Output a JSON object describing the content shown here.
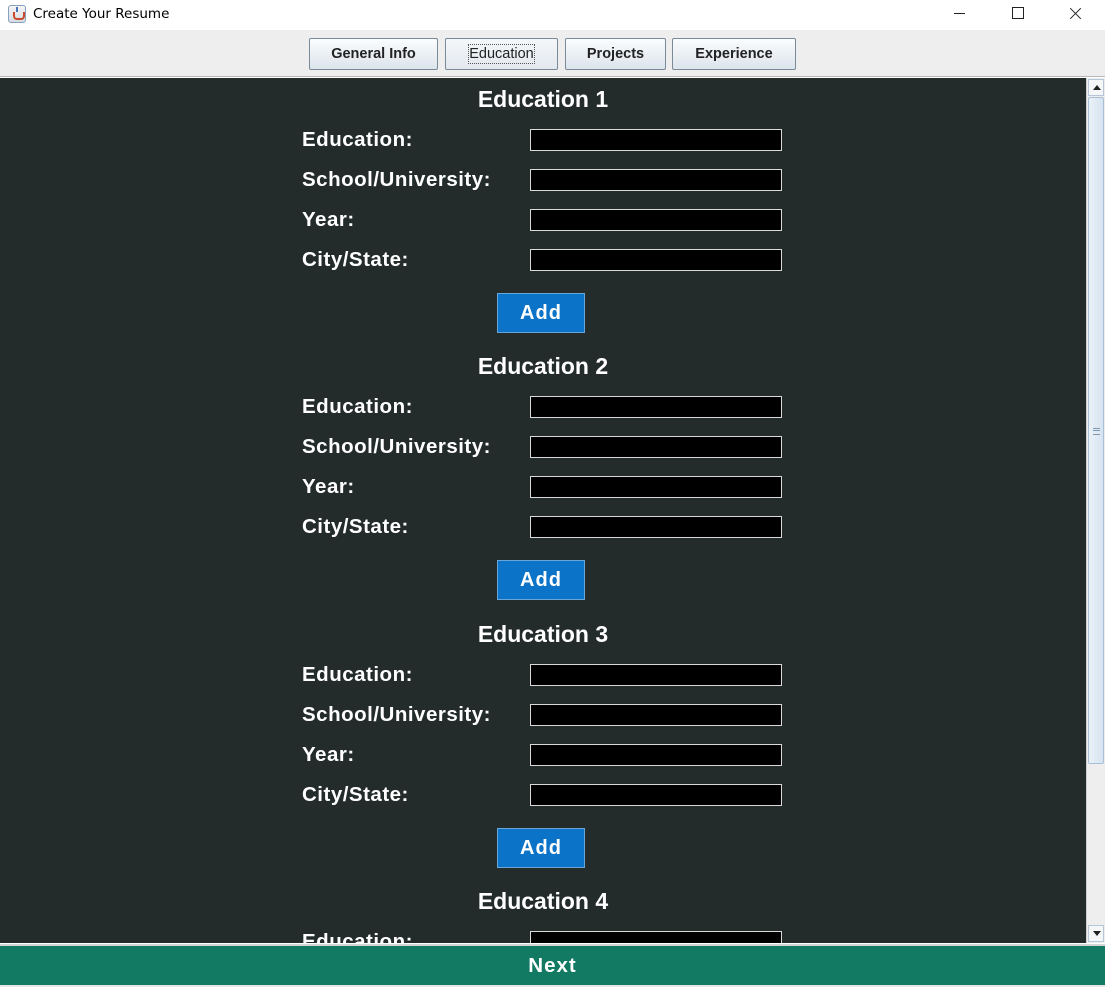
{
  "window": {
    "title": "Create Your Resume"
  },
  "tabs": [
    {
      "label": "General Info"
    },
    {
      "label": "Education"
    },
    {
      "label": "Projects"
    },
    {
      "label": "Experience"
    }
  ],
  "sections": [
    {
      "title": "Education 1",
      "fields": [
        {
          "label": "Education:",
          "value": ""
        },
        {
          "label": "School/University:",
          "value": ""
        },
        {
          "label": "Year:",
          "value": ""
        },
        {
          "label": "City/State:",
          "value": ""
        }
      ],
      "add_label": "Add"
    },
    {
      "title": "Education 2",
      "fields": [
        {
          "label": "Education:",
          "value": ""
        },
        {
          "label": "School/University:",
          "value": ""
        },
        {
          "label": "Year:",
          "value": ""
        },
        {
          "label": "City/State:",
          "value": ""
        }
      ],
      "add_label": "Add"
    },
    {
      "title": "Education 3",
      "fields": [
        {
          "label": "Education:",
          "value": ""
        },
        {
          "label": "School/University:",
          "value": ""
        },
        {
          "label": "Year:",
          "value": ""
        },
        {
          "label": "City/State:",
          "value": ""
        }
      ],
      "add_label": "Add"
    },
    {
      "title": "Education 4",
      "fields": [
        {
          "label": "Education:",
          "value": ""
        }
      ]
    }
  ],
  "footer": {
    "next_label": "Next"
  },
  "colors": {
    "panel_background": "#232b2b",
    "add_button": "#0c74c8",
    "next_bar": "#127a62",
    "input_background": "#000000"
  }
}
